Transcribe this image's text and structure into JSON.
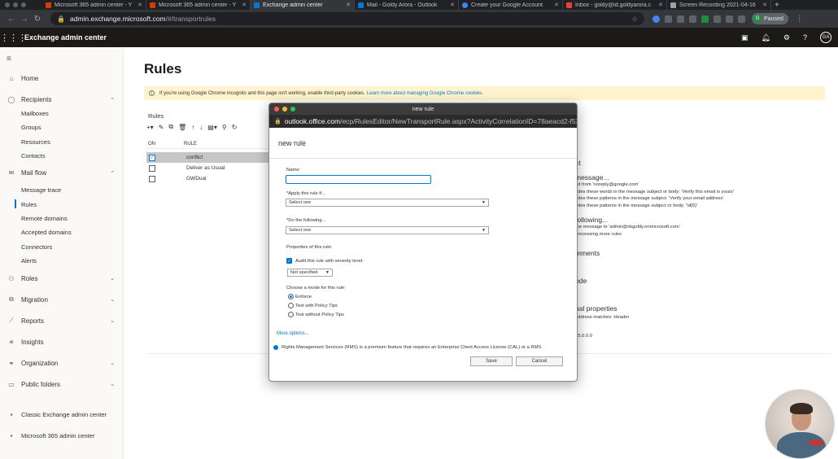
{
  "browser": {
    "tabs": [
      {
        "label": "Microsoft 365 admin center - Y",
        "color": "#d83b01",
        "active": false
      },
      {
        "label": "Microsoft 365 admin center - Y",
        "color": "#d83b01",
        "active": false
      },
      {
        "label": "Exchange admin center",
        "color": "#0078d4",
        "active": true
      },
      {
        "label": "Mail - Goldy Arora - Outlook",
        "color": "#0078d4",
        "active": false
      },
      {
        "label": "Create your Google Account",
        "color": "#4285f4",
        "active": false
      },
      {
        "label": "Inbox - goldy@id.goldyarora.c",
        "color": "#ea4335",
        "active": false
      },
      {
        "label": "Screen Recording 2021-04-16",
        "color": "#9aa0a6",
        "active": false
      }
    ],
    "url_domain": "admin.exchange.microsoft.com",
    "url_path": "/#/transportrules",
    "profile_label": "Paused",
    "profile_initial": "G"
  },
  "app": {
    "title": "Exchange admin center",
    "user_initials": "GA"
  },
  "sidebar": {
    "home": "Home",
    "recipients": "Recipients",
    "recipients_items": [
      "Mailboxes",
      "Groups",
      "Resources",
      "Contacts"
    ],
    "mailflow": "Mail flow",
    "mailflow_items": [
      "Message trace",
      "Rules",
      "Remote domains",
      "Accepted domains",
      "Connectors",
      "Alerts"
    ],
    "roles": "Roles",
    "migration": "Migration",
    "reports": "Reports",
    "insights": "Insights",
    "organization": "Organization",
    "public_folders": "Public folders",
    "classic": "Classic Exchange admin center",
    "m365": "Microsoft 365 admin center"
  },
  "main": {
    "title": "Rules",
    "banner_text": "If you're using Google Chrome incognito and this page isn't working, enable third-party cookies.",
    "banner_link": "Learn more about managing Google Chrome cookies.",
    "section_label": "Rules",
    "col_on": "ON",
    "col_rule": "RULE",
    "rules": [
      {
        "name": "conflict",
        "on": true,
        "selected": true
      },
      {
        "name": "Deliver as Usual",
        "on": false,
        "selected": false
      },
      {
        "name": "GWDual",
        "on": false,
        "selected": false
      }
    ],
    "details": {
      "h1": "ct",
      "h2": "message...",
      "lines1": [
        "ed from 'noreply@google.com'",
        "udes these words in the message subject or body: 'Verify this email is yours'",
        "udes these patterns in the message subject: 'Verify your email address'",
        "udes these patterns in the message subject or body: '\\d{6}'"
      ],
      "h3": "following...",
      "lines2": [
        "the message to 'admin@okgoldy.onmicrosoft.com'",
        "processing more rules"
      ],
      "h4": "mments",
      "h5": "ode",
      "h6": "nal properties",
      "lines3": [
        "address matches: Header"
      ],
      "version": "15.0.0.0"
    }
  },
  "popup": {
    "window_title": "new rule",
    "url_domain": "outlook.office.com",
    "url_path": "/ecp/RulesEditor/NewTransportRule.aspx?ActivityCorrelationID=78aeacd2-f53...",
    "heading": "new rule",
    "name_label": "Name:",
    "apply_label": "*Apply this rule if...",
    "apply_value": "Select one",
    "do_label": "*Do the following...",
    "do_value": "Select one",
    "properties_label": "Properties of this rule:",
    "audit_label": "Audit this rule with severity level:",
    "severity_value": "Not specified",
    "mode_label": "Choose a mode for this rule:",
    "modes": [
      "Enforce",
      "Test with Policy Tips",
      "Test without Policy Tips"
    ],
    "more_options": "More options...",
    "rms_text": "Rights Management Services (RMS) is a premium feature that requires an Enterprise Client Access License (CAL) or a RMS",
    "save": "Save",
    "cancel": "Cancel"
  }
}
